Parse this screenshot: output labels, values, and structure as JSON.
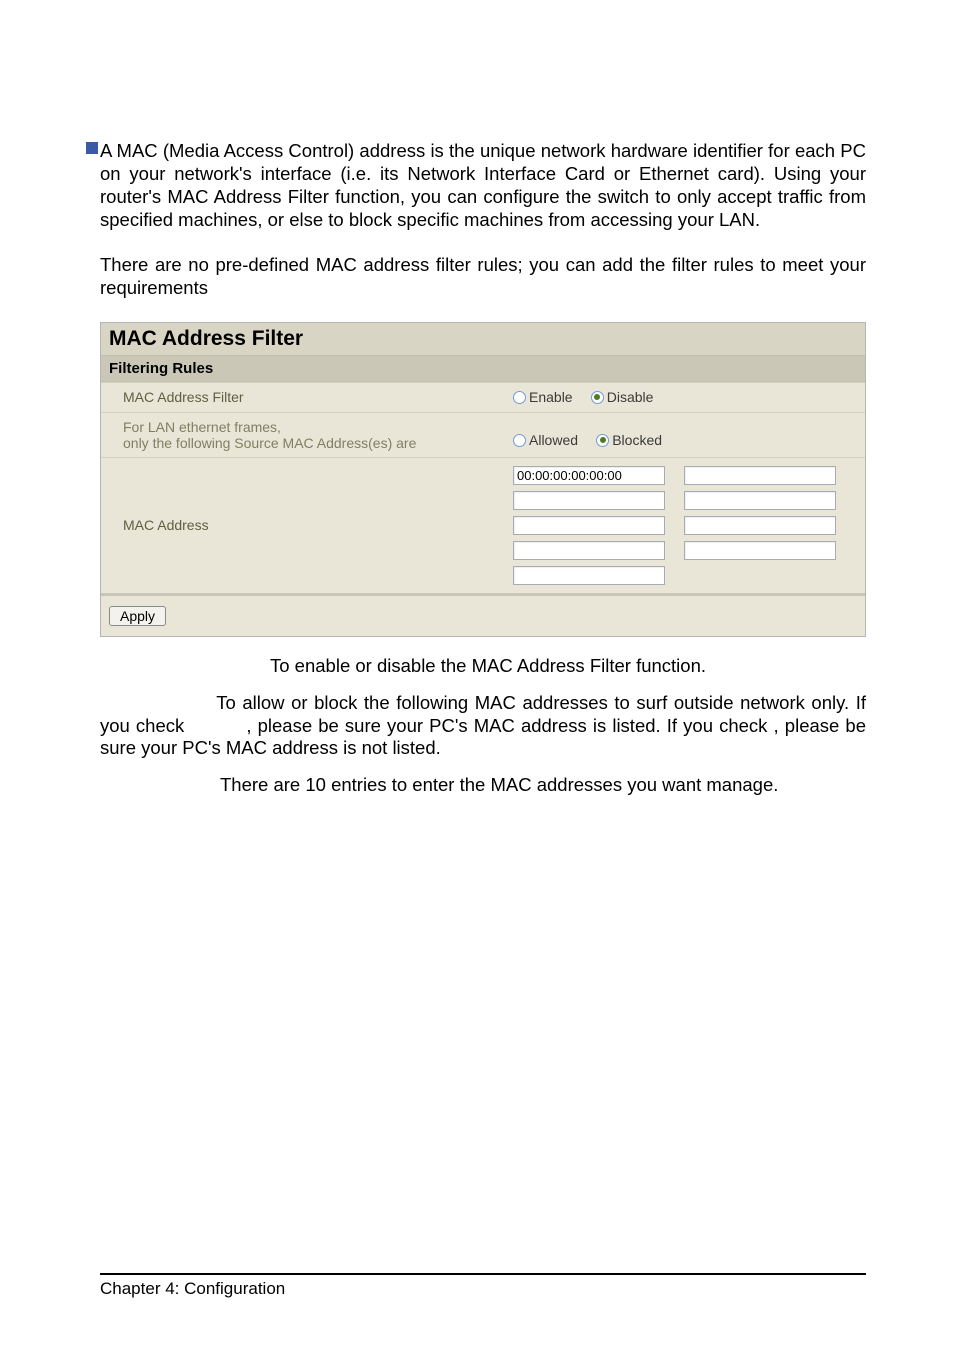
{
  "blue_square": true,
  "paragraphs": {
    "p1": "A MAC (Media Access Control) address is the unique network hardware identifier for each PC on your network's interface (i.e. its Network Interface Card or Ethernet card). Using your router's MAC Address Filter function, you can configure the switch to only accept traffic from specified machines, or else to block specific machines from accessing your LAN.",
    "p2": "There are no pre-defined MAC address filter rules; you can add the filter rules to meet your requirements"
  },
  "panel": {
    "title": "MAC Address Filter",
    "subtitle": "Filtering Rules",
    "row1_label": "MAC Address Filter",
    "row1_enable": "Enable",
    "row1_disable": "Disable",
    "row1_selected": "disable",
    "row2_line1": "For LAN ethernet frames,",
    "row2_line2": "only the following Source MAC Address(es) are",
    "row2_allowed": "Allowed",
    "row2_blocked": "Blocked",
    "row2_selected": "blocked",
    "row3_label": "MAC Address",
    "mac_inputs": [
      "00:00:00:00:00:00",
      "",
      "",
      "",
      "",
      "",
      "",
      "",
      "",
      ""
    ],
    "apply_label": "Apply"
  },
  "descriptions": {
    "d1": " To enable or disable the MAC Address Filter function.",
    "d2a": " To allow or block the following MAC addresses to surf outside network only. If you check ",
    "d2b": ", please be sure your PC's MAC address is listed. If you check ",
    "d2c": ", please be sure your PC's MAC address is not listed.",
    "d3": " There are 10 entries to enter the MAC addresses you want manage."
  },
  "footer": "Chapter 4: Configuration",
  "page_number": ""
}
